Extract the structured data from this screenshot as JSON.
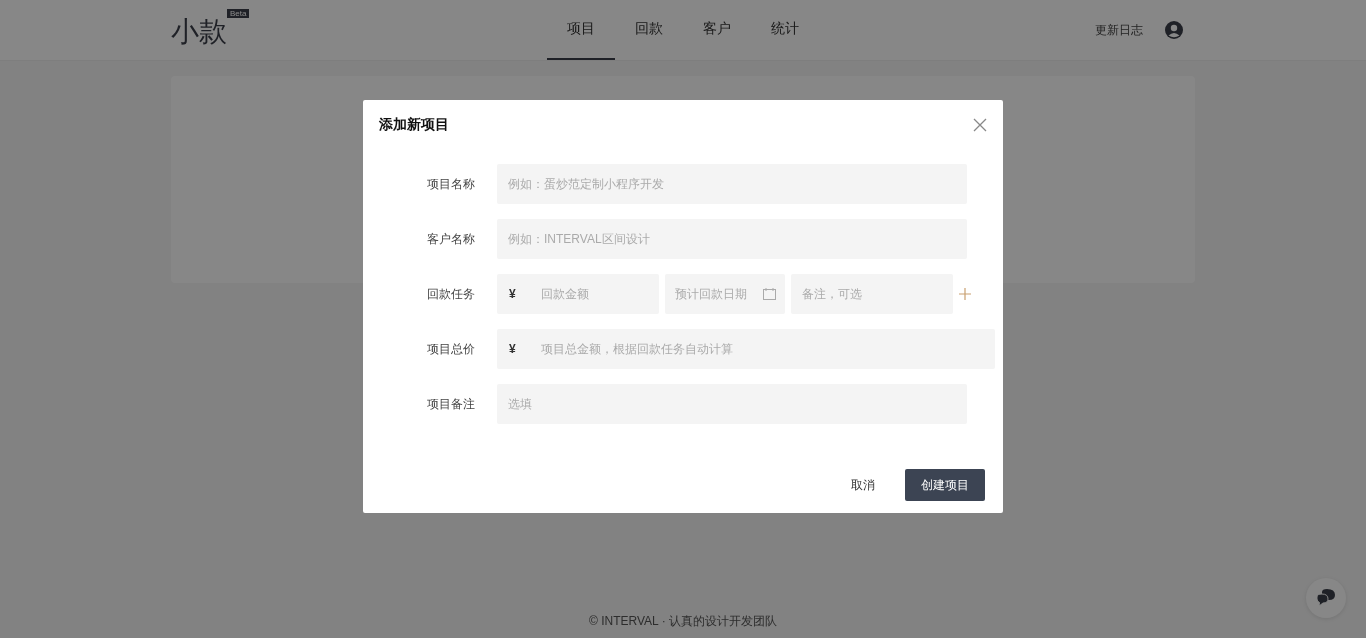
{
  "header": {
    "logo": "小款",
    "badge": "Beta",
    "nav": [
      {
        "label": "项目",
        "selected": true
      },
      {
        "label": "回款",
        "selected": false
      },
      {
        "label": "客户",
        "selected": false
      },
      {
        "label": "统计",
        "selected": false
      }
    ],
    "changelog": "更新日志"
  },
  "dialog": {
    "title": "添加新项目",
    "fields": [
      {
        "kind": "text",
        "label": "项目名称",
        "placeholder": "例如：蛋炒范定制小程序开发"
      },
      {
        "kind": "text",
        "label": "客户名称",
        "placeholder": "例如：INTERVAL区间设计"
      },
      {
        "kind": "payment",
        "label": "回款任务",
        "currency": "¥",
        "amount_placeholder": "回款金额",
        "date_placeholder": "预计回款日期",
        "note_placeholder": "备注，可选"
      },
      {
        "kind": "currency",
        "label": "项目总价",
        "currency": "¥",
        "placeholder": "项目总金额，根据回款任务自动计算"
      },
      {
        "kind": "text",
        "label": "项目备注",
        "placeholder": "选填"
      }
    ],
    "cancel": "取消",
    "submit": "创建项目"
  },
  "footer": "© INTERVAL · 认真的设计开发团队"
}
